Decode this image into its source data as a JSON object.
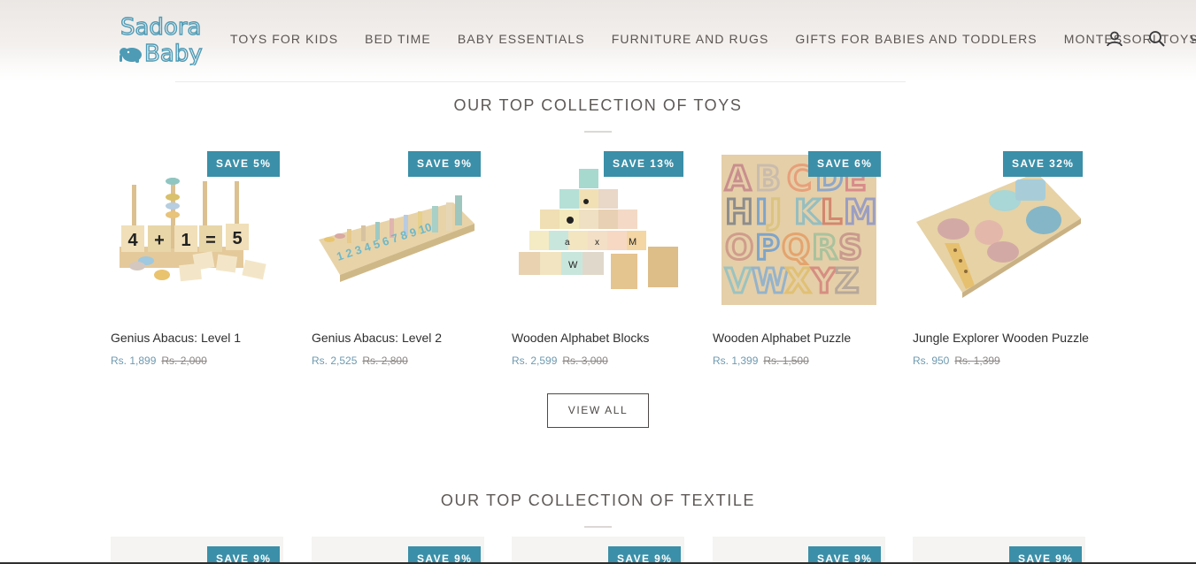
{
  "brand": {
    "line1": "Sadora",
    "line2": "Baby",
    "color": "#4e9bb6"
  },
  "nav": {
    "items": [
      {
        "label": "TOYS FOR KIDS"
      },
      {
        "label": "BED TIME"
      },
      {
        "label": "BABY ESSENTIALS"
      },
      {
        "label": "FURNITURE AND RUGS"
      },
      {
        "label": "GIFTS FOR BABIES AND TODDLERS"
      },
      {
        "label": "MONTESSORI TOYS"
      }
    ],
    "icons": [
      "account-icon",
      "search-icon",
      "cart-icon"
    ]
  },
  "toys_section": {
    "title": "OUR TOP COLLECTION OF TOYS",
    "products": [
      {
        "name": "Genius Abacus: Level 1",
        "badge": "SAVE 5%",
        "price": "Rs. 1,899",
        "compare_price": "Rs. 2,000"
      },
      {
        "name": "Genius Abacus: Level 2",
        "badge": "SAVE 9%",
        "price": "Rs. 2,525",
        "compare_price": "Rs. 2,800"
      },
      {
        "name": "Wooden Alphabet Blocks",
        "badge": "SAVE 13%",
        "price": "Rs. 2,599",
        "compare_price": "Rs. 3,000"
      },
      {
        "name": "Wooden Alphabet Puzzle",
        "badge": "SAVE 6%",
        "price": "Rs. 1,399",
        "compare_price": "Rs. 1,500"
      },
      {
        "name": "Jungle Explorer Wooden Puzzle",
        "badge": "SAVE 32%",
        "price": "Rs. 950",
        "compare_price": "Rs. 1,399"
      }
    ],
    "view_all_label": "VIEW ALL"
  },
  "textile_section": {
    "title": "OUR TOP COLLECTION OF TEXTILE",
    "badges": [
      "SAVE 9%",
      "SAVE 9%",
      "SAVE 9%",
      "SAVE 9%",
      "SAVE 9%"
    ]
  },
  "colors": {
    "accent": "#3b8fa8",
    "sale_price": "#6e9ab0",
    "text": "#2f2f2f"
  }
}
